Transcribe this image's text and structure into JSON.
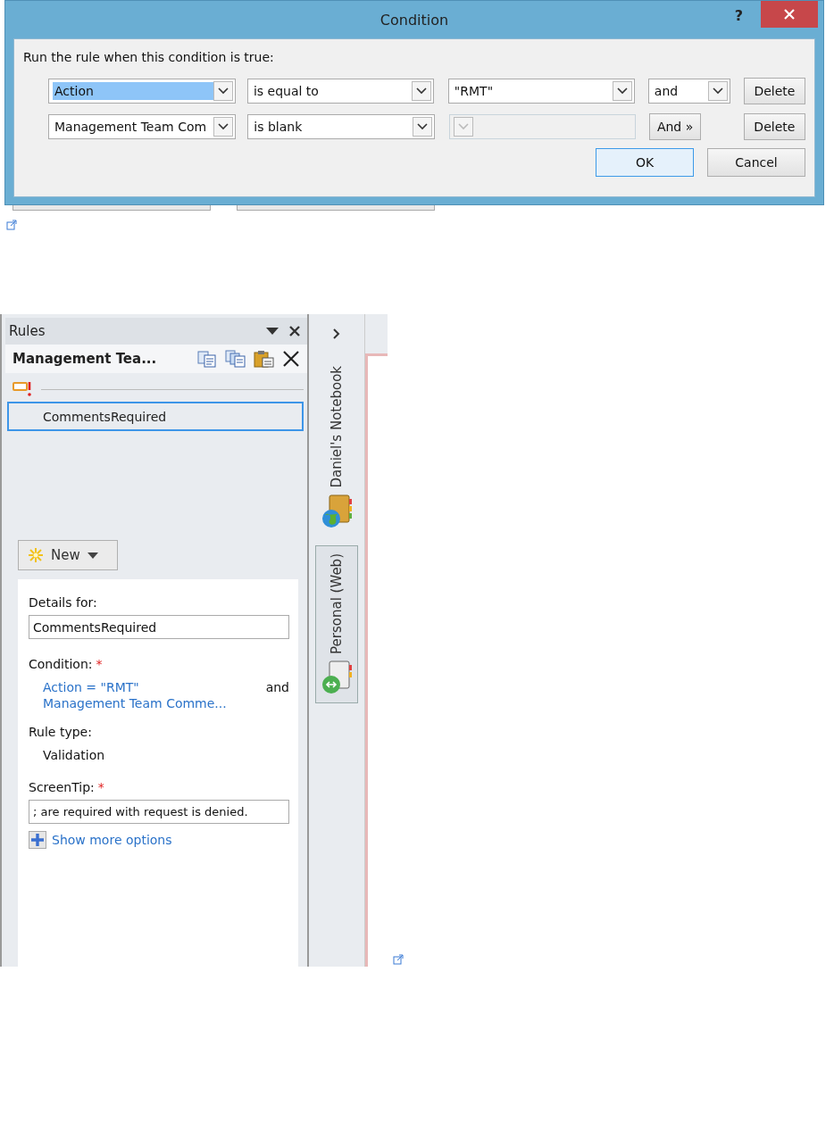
{
  "dialog": {
    "title": "Condition",
    "help": "?",
    "prompt": "Run the rule when this condition is true:",
    "rows": [
      {
        "field": "Action",
        "field_selected": true,
        "operator": "is equal to",
        "value": "\"RMT\"",
        "value_disabled": false,
        "kind": "dropdown",
        "joiner": "and",
        "delete": "Delete"
      },
      {
        "field": "Management Team Com",
        "field_selected": false,
        "operator": "is blank",
        "value_disabled": true,
        "kind": "button",
        "joiner": "And »",
        "delete": "Delete"
      }
    ],
    "buttons": [
      {
        "label": "OK",
        "default": true
      },
      {
        "label": "Cancel",
        "default": false
      }
    ]
  },
  "rules_pane": {
    "title": "Rules",
    "rule_set_name": "Management Tea...",
    "rules": [
      {
        "name": "CommentsRequired",
        "selected": true
      }
    ],
    "new_button": "New",
    "details_label": "Details for:",
    "details_value": "CommentsRequired",
    "condition_label": "Condition:",
    "condition_required": "*",
    "condition_lines": [
      "Action = \"RMT\"",
      "Management Team Comme..."
    ],
    "condition_joiner": "and",
    "rule_type_label": "Rule type:",
    "rule_type": "Validation",
    "screentip_label": "ScreenTip:",
    "screentip_required": "*",
    "screentip_value": "; are required with request is denied.",
    "more_options": "Show more options"
  },
  "notebook_tabs": [
    {
      "label": "Daniel's Notebook",
      "selected": false
    },
    {
      "label": "Personal (Web)",
      "selected": true
    }
  ]
}
